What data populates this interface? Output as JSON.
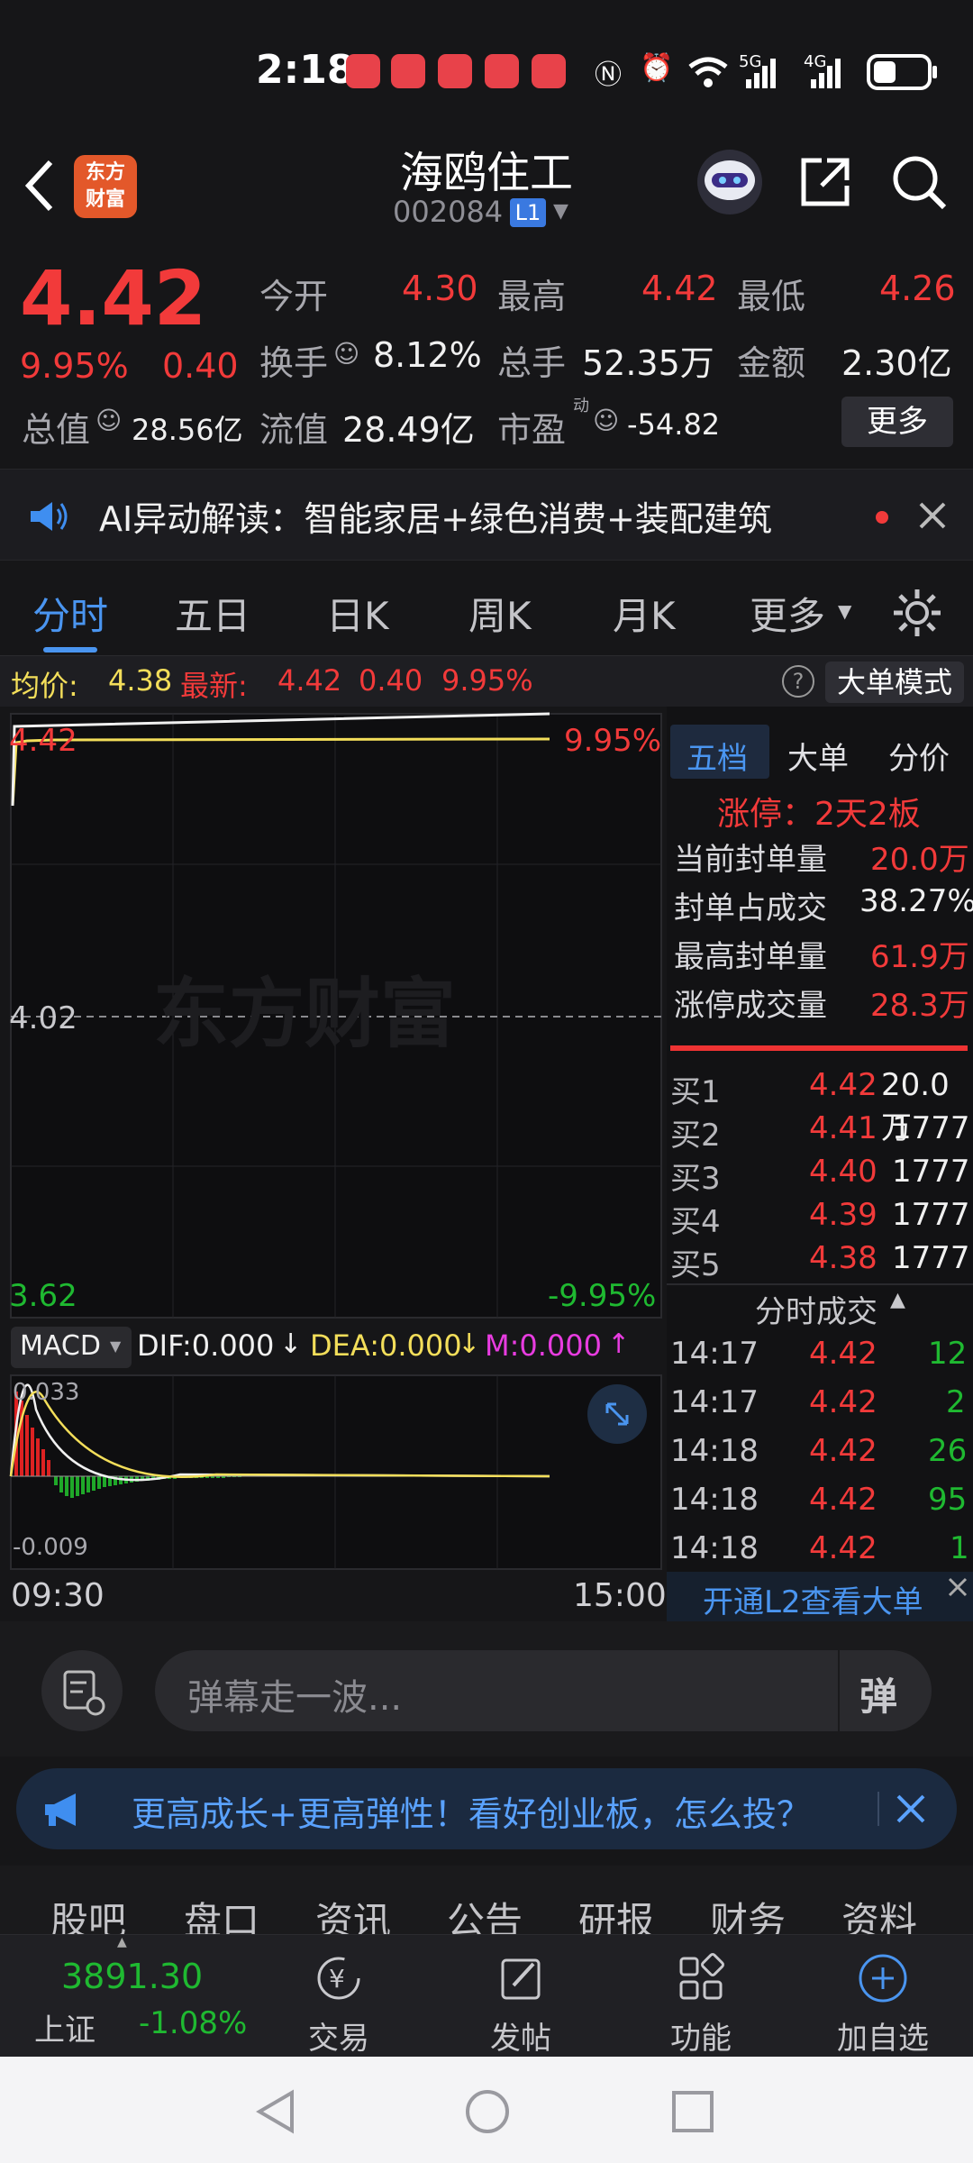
{
  "status_bar": {
    "time": "2:18",
    "signal1": "5G",
    "signal2": "4G"
  },
  "header": {
    "logo_line1": "东方",
    "logo_line2": "财富",
    "stock_name": "海鸥住工",
    "stock_code": "002084",
    "level_badge": "L1"
  },
  "quote": {
    "price": "4.42",
    "change_pct": "9.95%",
    "change": "0.40",
    "open_label": "今开",
    "open": "4.30",
    "high_label": "最高",
    "high": "4.42",
    "low_label": "最低",
    "low": "4.26",
    "turnover_label": "换手",
    "turnover": "8.12%",
    "volume_label": "总手",
    "volume": "52.35万",
    "amount_label": "金额",
    "amount": "2.30亿",
    "mktcap_label": "总值",
    "mktcap": "28.56亿",
    "float_label": "流值",
    "float": "28.49亿",
    "pe_label": "市盈",
    "pe_sup": "动",
    "pe": "-54.82",
    "more_button": "更多"
  },
  "alert": {
    "text": "AI异动解读：智能家居+绿色消费+装配建筑"
  },
  "tabs": [
    "分时",
    "五日",
    "日K",
    "周K",
    "月K",
    "更多"
  ],
  "infobar": {
    "avg_label": "均价:",
    "avg": "4.38",
    "latest_label": "最新:",
    "latest": "4.42",
    "change": "0.40",
    "pct": "9.95%",
    "mode_button": "大单模式"
  },
  "chart": {
    "price_top": "4.42",
    "pct_top": "9.95%",
    "price_mid": "4.02",
    "price_bottom": "3.62",
    "pct_bottom": "-9.95%",
    "watermark": "东方财富",
    "macd_label": "MACD",
    "dif": "DIF:0.000",
    "dea": "DEA:0.000",
    "m": "M:0.000",
    "macd_top": "0.033",
    "macd_bottom": "-0.009",
    "time_start": "09:30",
    "time_end": "15:00"
  },
  "side": {
    "tabs": [
      "五档",
      "大单",
      "分价"
    ],
    "limit_title": "涨停：2天2板",
    "stats": [
      {
        "label": "当前封单量",
        "value": "20.0万"
      },
      {
        "label": "封单占成交",
        "value": "38.27%"
      },
      {
        "label": "最高封单量",
        "value": "61.9万"
      },
      {
        "label": "涨停成交量",
        "value": "28.3万"
      }
    ],
    "bids": [
      {
        "label": "买1",
        "price": "4.42",
        "vol": "20.0万"
      },
      {
        "label": "买2",
        "price": "4.41",
        "vol": "1777"
      },
      {
        "label": "买3",
        "price": "4.40",
        "vol": "1777"
      },
      {
        "label": "买4",
        "price": "4.39",
        "vol": "1777"
      },
      {
        "label": "买5",
        "price": "4.38",
        "vol": "1777"
      }
    ],
    "ticks_title": "分时成交",
    "ticks": [
      {
        "time": "14:17",
        "price": "4.42",
        "vol": "12"
      },
      {
        "time": "14:17",
        "price": "4.42",
        "vol": "2"
      },
      {
        "time": "14:18",
        "price": "4.42",
        "vol": "26"
      },
      {
        "time": "14:18",
        "price": "4.42",
        "vol": "95"
      },
      {
        "time": "14:18",
        "price": "4.42",
        "vol": "1"
      }
    ],
    "l2_link": "开通L2查看大单"
  },
  "comment": {
    "placeholder": "弹幕走一波...",
    "danmu_glyph": "弹"
  },
  "promo": {
    "text": "更高成长+更高弹性！看好创业板，怎么投？"
  },
  "subtabs": [
    "股吧",
    "盘口",
    "资讯",
    "公告",
    "研报",
    "财务",
    "资料"
  ],
  "bottom": {
    "index_value": "3891.30",
    "index_name": "上证",
    "index_pct": "-1.08%",
    "trade": "交易",
    "post": "发帖",
    "features": "功能",
    "add_watch": "加自选"
  },
  "colors": {
    "up": "#f23a3a",
    "down": "#1fb931",
    "accent": "#4a95f0",
    "avg": "#f3de5a"
  }
}
